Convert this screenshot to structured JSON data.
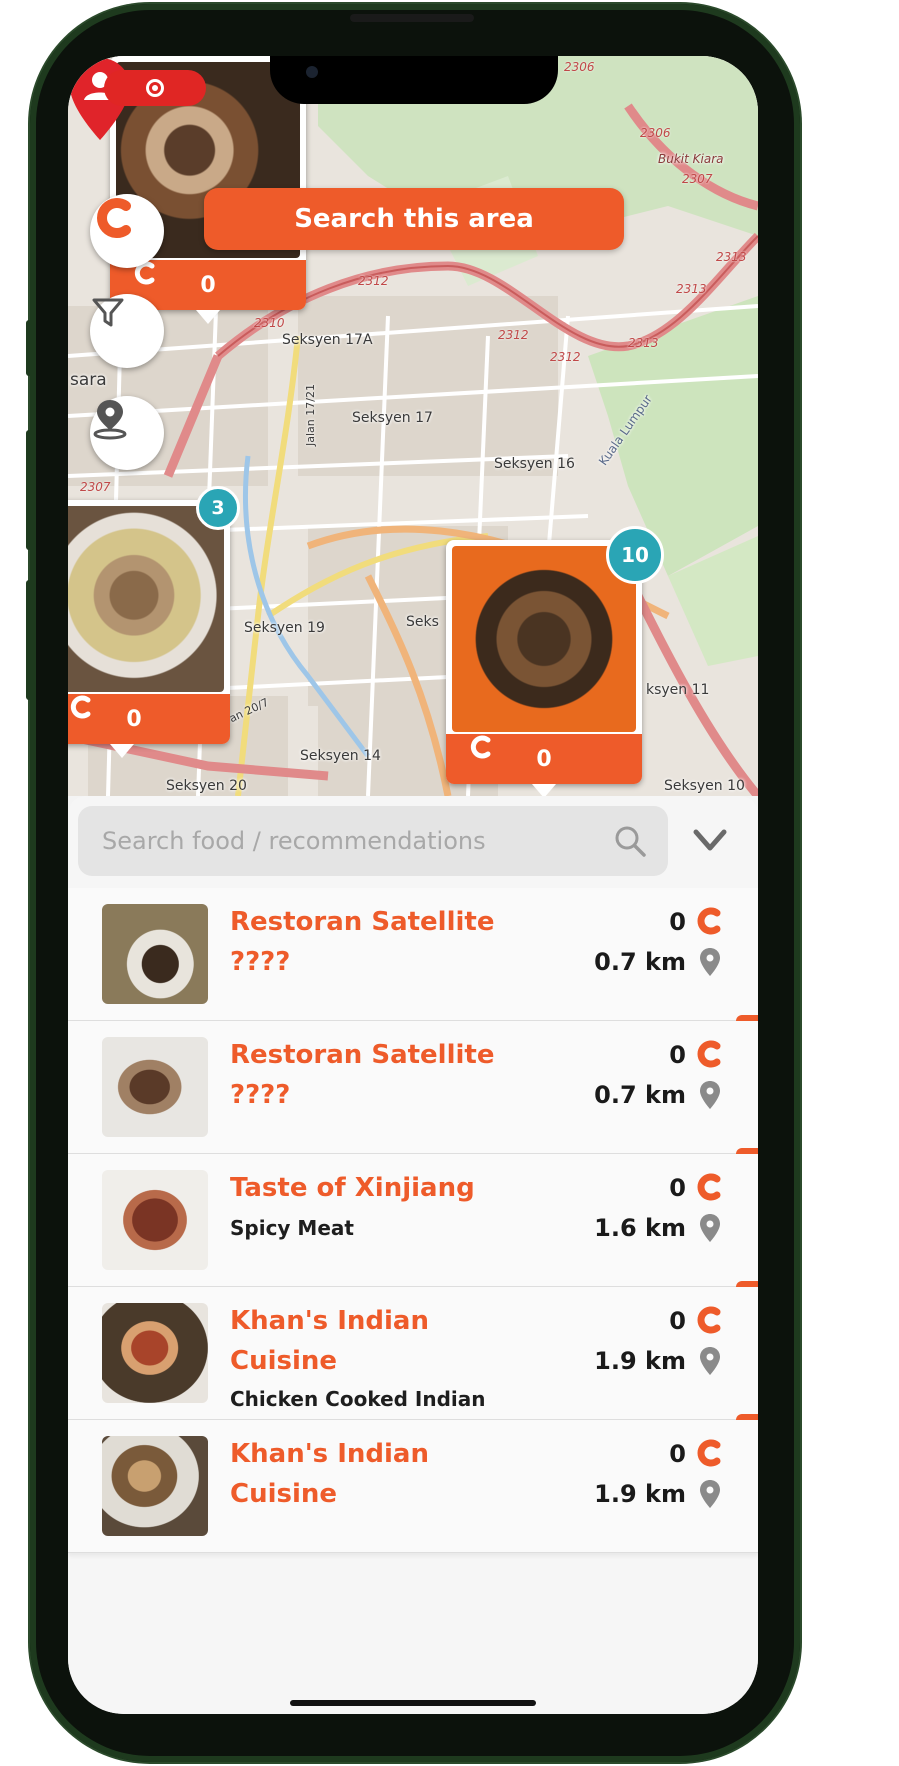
{
  "map": {
    "search_area_label": "Search this area",
    "places": {
      "s17a": "Seksyen 17A",
      "s17": "Seksyen 17",
      "s16": "Seksyen 16",
      "s19": "Seksyen 19",
      "seks": "Seks",
      "s14": "Seksyen 14",
      "s20": "Seksyen 20",
      "s10": "Seksyen 10",
      "s11": "ksyen 11",
      "sara": "sara",
      "jalan1721": "Jalan 17/21",
      "jalan207": "an 20/7",
      "bukit": "Bukit Kiara",
      "kualalumpur": "Kuala Lumpur"
    },
    "road_numbers": [
      "2306",
      "2306",
      "2307",
      "2313",
      "2313",
      "2312",
      "2312",
      "2312",
      "2313",
      "2310",
      "2307"
    ],
    "markers": [
      {
        "count": "0",
        "badge": ""
      },
      {
        "count": "0",
        "badge": "3"
      },
      {
        "count": "0",
        "badge": "10"
      }
    ]
  },
  "sheet": {
    "search_placeholder": "Search food / recommendations",
    "items": [
      {
        "name": "Restoran Satellite ????",
        "subtitle": "",
        "score": "0",
        "distance": "0.7 km"
      },
      {
        "name": "Restoran Satellite ????",
        "subtitle": "",
        "score": "0",
        "distance": "0.7 km"
      },
      {
        "name": "Taste of Xinjiang",
        "subtitle": "Spicy Meat",
        "score": "0",
        "distance": "1.6 km"
      },
      {
        "name": "Khan's Indian Cuisine",
        "subtitle": "Chicken Cooked Indian",
        "score": "0",
        "distance": "1.9 km"
      },
      {
        "name": "Khan's Indian Cuisine",
        "subtitle": "",
        "score": "0",
        "distance": "1.9 km"
      }
    ]
  },
  "colors": {
    "brand_orange": "#ee5b2a",
    "badge_teal": "#2aa5b5",
    "record_red": "#e02624",
    "phone_frame_green": "#1e3a1e"
  },
  "icons": [
    "record-icon",
    "brand-c-icon",
    "filter-icon",
    "location-icon",
    "user-location-pin-icon",
    "search-icon",
    "chevron-down-icon",
    "map-pin-icon"
  ]
}
